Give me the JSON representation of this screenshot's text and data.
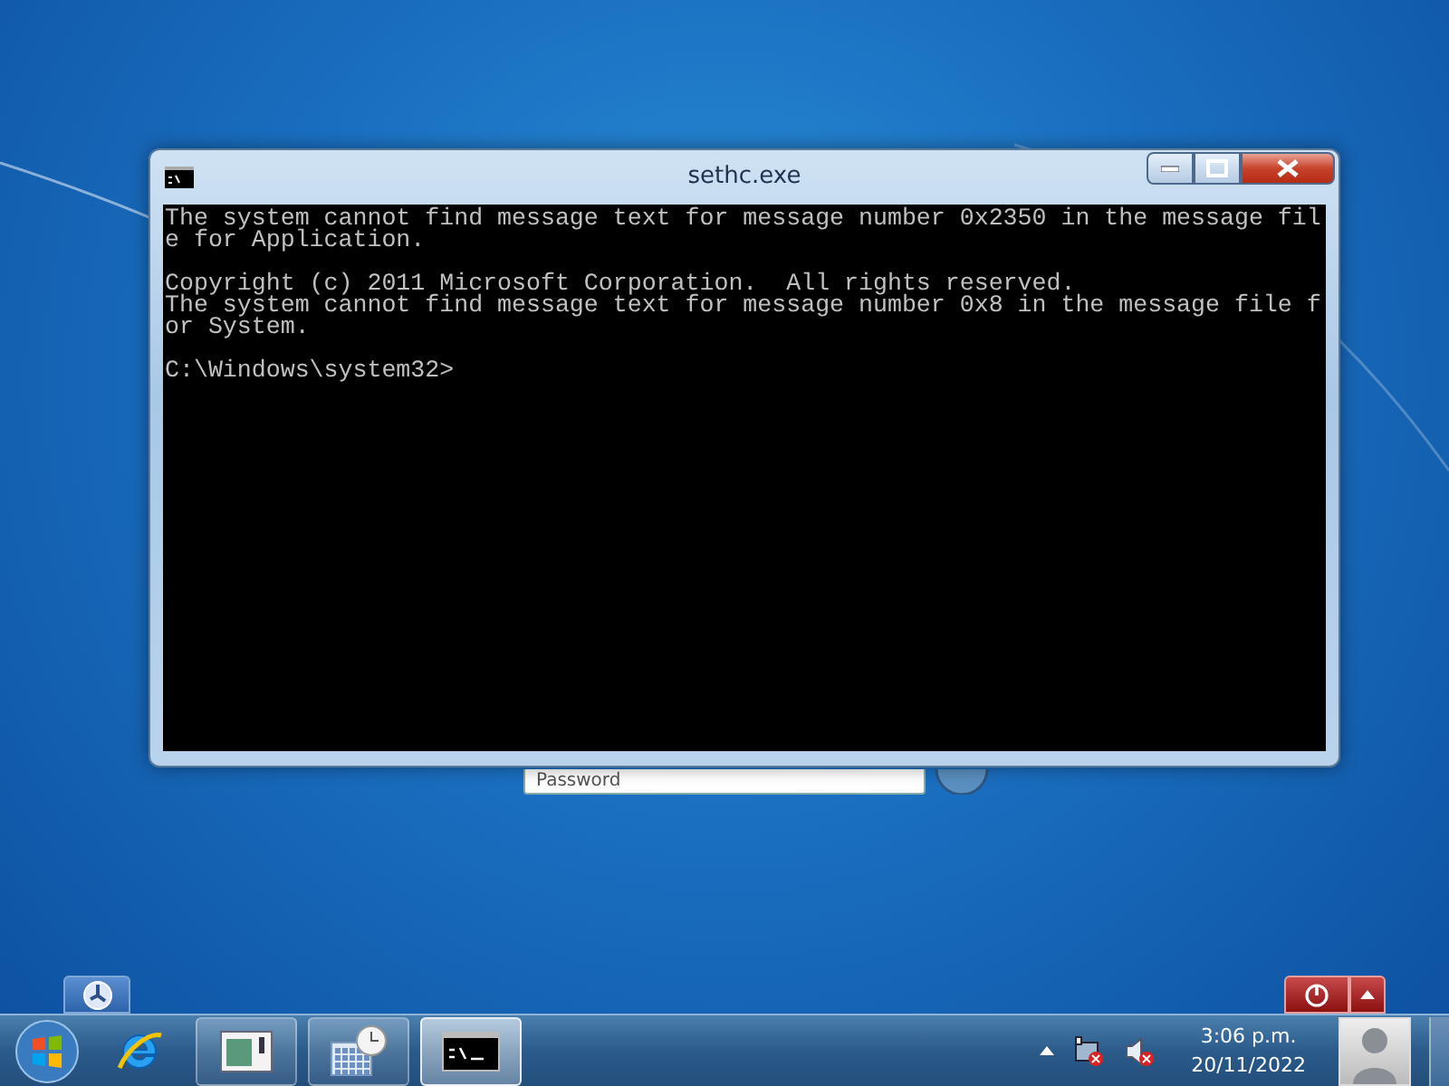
{
  "window": {
    "title": "sethc.exe",
    "console_blocks": [
      [
        "The system cannot find message text for message number 0x2350 in the message fil",
        "e for Application."
      ],
      [
        "Copyright (c) 2011 Microsoft Corporation.  All rights reserved.",
        "The system cannot find message text for message number 0x8 in the message file f",
        "or System."
      ],
      [
        "C:\\Windows\\system32>"
      ]
    ]
  },
  "login": {
    "password": {
      "placeholder": "Password"
    }
  },
  "taskbar": {
    "items": [
      {
        "kind": "ie",
        "selected": false
      },
      {
        "kind": "panel",
        "selected": false
      },
      {
        "kind": "calendar",
        "selected": false
      },
      {
        "kind": "console",
        "selected": true
      }
    ],
    "clock": {
      "time": "3:06 p.m.",
      "date": "20/11/2022"
    }
  }
}
